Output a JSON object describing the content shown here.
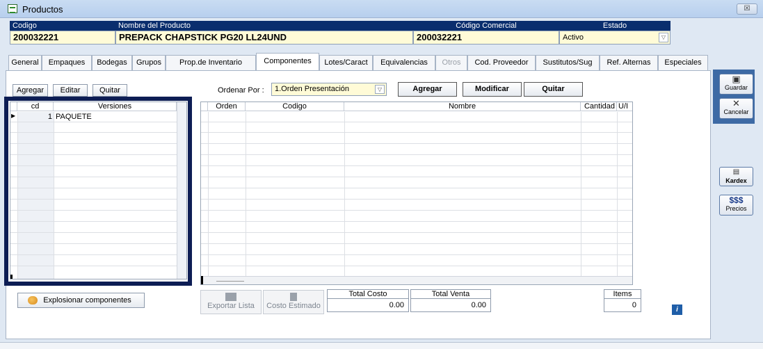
{
  "window": {
    "title": "Productos",
    "close_label": "☒"
  },
  "header": {
    "codigo": {
      "label": "Codigo",
      "value": "200032221"
    },
    "nombre": {
      "label": "Nombre del Producto",
      "value": "PREPACK CHAPSTICK PG20 LL24UND"
    },
    "codigo_comercial": {
      "label": "Código Comercial",
      "value": "200032221"
    },
    "estado": {
      "label": "Estado",
      "value": "Activo"
    }
  },
  "tabs": [
    {
      "label": "General"
    },
    {
      "label": "Empaques"
    },
    {
      "label": "Bodegas"
    },
    {
      "label": "Grupos"
    },
    {
      "label": "Prop.de Inventario"
    },
    {
      "label": "Componentes",
      "active": true
    },
    {
      "label": "Lotes/Caract"
    },
    {
      "label": "Equivalencias"
    },
    {
      "label": "Otros",
      "disabled": true
    },
    {
      "label": "Cod. Proveedor"
    },
    {
      "label": "Sustitutos/Sug"
    },
    {
      "label": "Ref. Alternas"
    },
    {
      "label": "Especiales"
    }
  ],
  "versions": {
    "buttons": {
      "agregar": "Agregar",
      "editar": "Editar",
      "quitar": "Quitar"
    },
    "columns": {
      "cd": "cd",
      "versiones": "Versiones"
    },
    "rows": [
      {
        "cd": "1",
        "version": "PAQUETE"
      }
    ]
  },
  "components": {
    "ordenar_label": "Ordenar Por :",
    "ordenar_value": "1.Orden Presentación",
    "buttons": {
      "agregar": "Agregar",
      "modificar": "Modificar",
      "quitar": "Quitar"
    },
    "columns": {
      "orden": "Orden",
      "codigo": "Codigo",
      "nombre": "Nombre",
      "cantidad": "Cantidad",
      "um": "U/I"
    }
  },
  "footer": {
    "explosionar": "Explosionar componentes",
    "exportar": "Exportar Lista",
    "costo_estimado": "Costo Estimado",
    "total_costo_label": "Total Costo",
    "total_costo_value": "0.00",
    "total_venta_label": "Total Venta",
    "total_venta_value": "0.00",
    "items_label": "Items",
    "items_value": "0",
    "info_label": "i"
  },
  "toolbar": {
    "guardar": "Guardar",
    "cancelar": "Cancelar",
    "kardex": "Kardex",
    "precios_symbol": "$$$",
    "precios": "Precios"
  }
}
